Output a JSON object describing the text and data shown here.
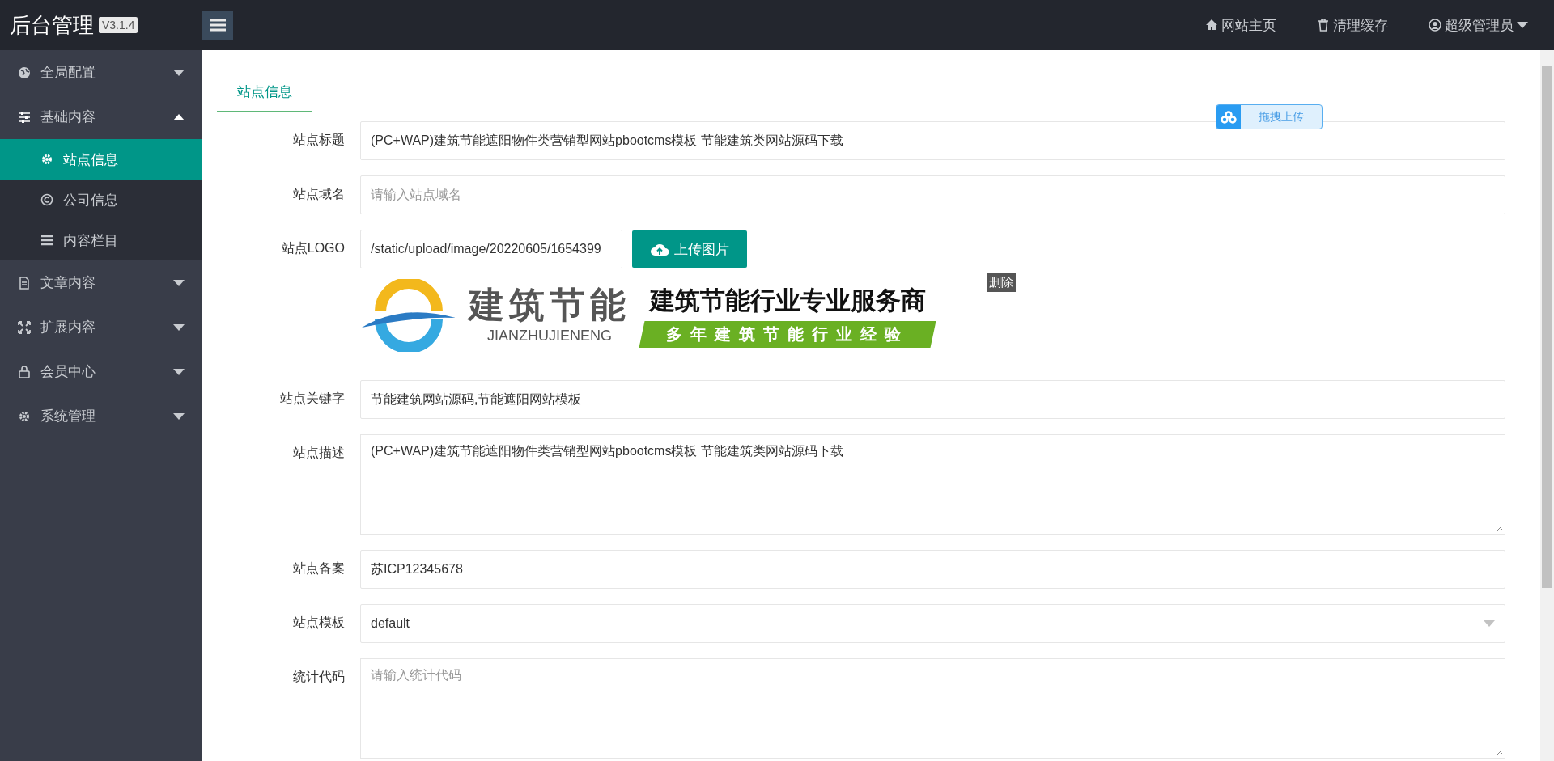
{
  "header": {
    "title": "后台管理",
    "version": "V3.1.4",
    "links": [
      {
        "kind": "home",
        "label": "网站主页"
      },
      {
        "kind": "trash",
        "label": "清理缓存"
      },
      {
        "kind": "user",
        "label": "超级管理员"
      }
    ]
  },
  "sidebar": {
    "items": [
      {
        "label": "全局配置",
        "expanded": false
      },
      {
        "label": "基础内容",
        "expanded": true,
        "children": [
          {
            "label": "站点信息",
            "selected": true
          },
          {
            "label": "公司信息",
            "selected": false
          },
          {
            "label": "内容栏目",
            "selected": false
          }
        ]
      },
      {
        "label": "文章内容",
        "expanded": false
      },
      {
        "label": "扩展内容",
        "expanded": false
      },
      {
        "label": "会员中心",
        "expanded": false
      },
      {
        "label": "系统管理",
        "expanded": false
      }
    ]
  },
  "tabs": [
    {
      "label": "站点信息",
      "selected": true
    }
  ],
  "drag_upload_badge": {
    "label": "拖拽上传"
  },
  "form": {
    "fields": [
      {
        "kind": "text",
        "label": "站点标题",
        "value": "(PC+WAP)建筑节能遮阳物件类营销型网站pbootcms模板 节能建筑类网站源码下载"
      },
      {
        "kind": "text",
        "label": "站点域名",
        "placeholder": "请输入站点域名"
      },
      {
        "kind": "image",
        "label": "站点LOGO",
        "value": "/static/upload/image/20220605/1654399",
        "button": "上传图片",
        "delete": "删除",
        "logo": {
          "brand": "建筑节能",
          "pinyin": "JIANZHUJIENENG",
          "slogan": "建筑节能行业专业服务商",
          "banner": "多年建筑节能行业经验"
        }
      },
      {
        "kind": "text",
        "label": "站点关键字",
        "value": "节能建筑网站源码,节能遮阳网站模板"
      },
      {
        "kind": "textarea",
        "label": "站点描述",
        "value": "(PC+WAP)建筑节能遮阳物件类营销型网站pbootcms模板 节能建筑类网站源码下载"
      },
      {
        "kind": "text",
        "label": "站点备案",
        "value": "苏ICP12345678"
      },
      {
        "kind": "select",
        "label": "站点模板",
        "value": "default"
      },
      {
        "kind": "textarea",
        "label": "统计代码",
        "placeholder": "请输入统计代码"
      }
    ]
  }
}
